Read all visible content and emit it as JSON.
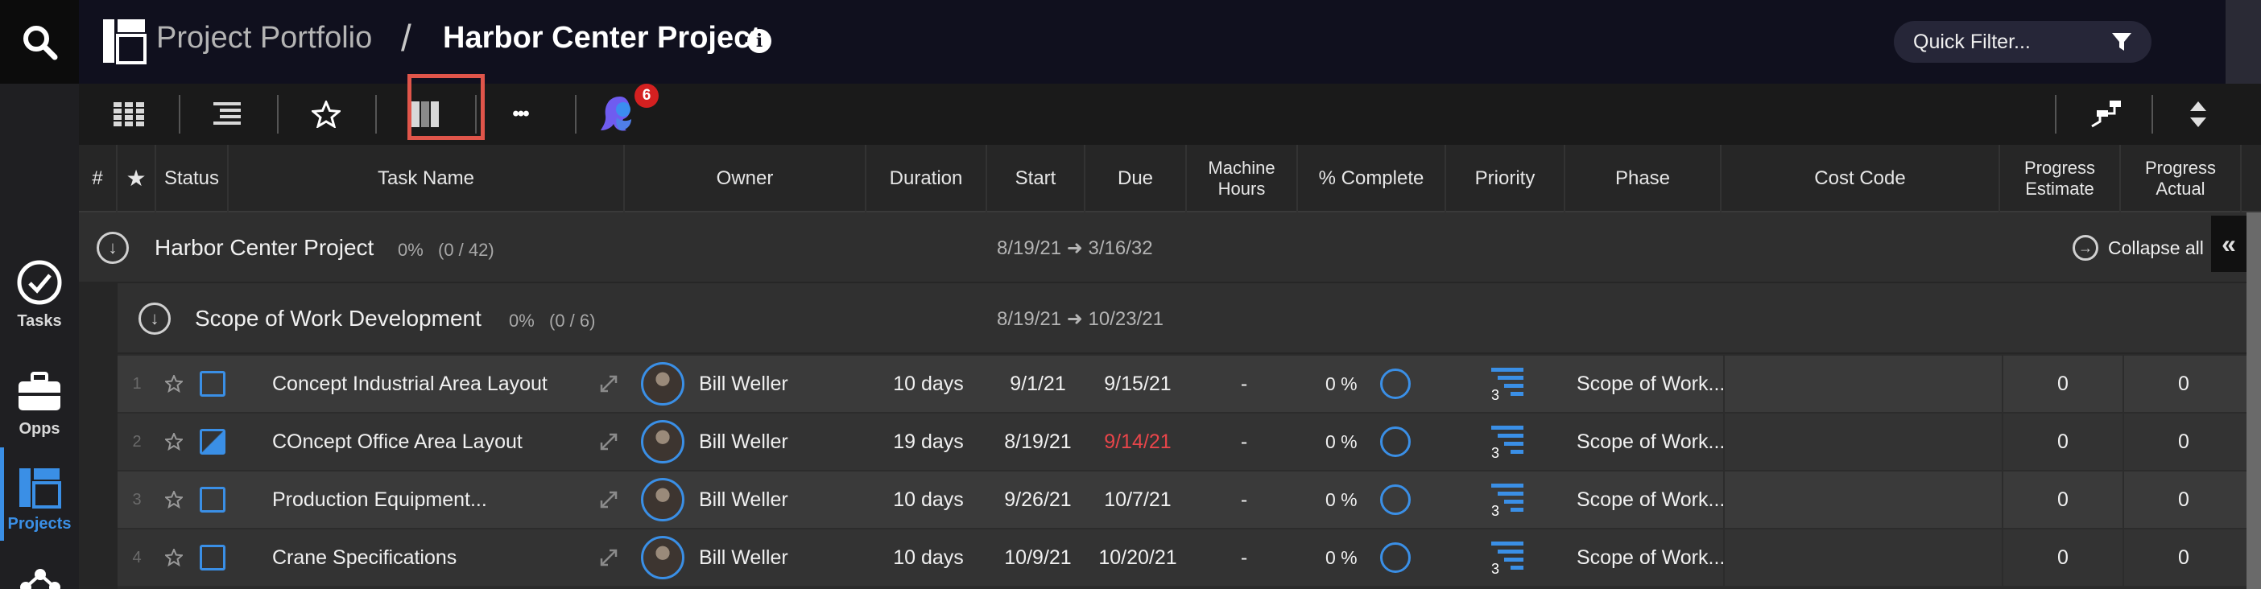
{
  "header": {
    "portfolio": "Project Portfolio",
    "separator": "/",
    "project": "Harbor Center Project",
    "info_glyph": "i",
    "quick_filter_placeholder": "Quick Filter..."
  },
  "sidebar": {
    "items": [
      {
        "label": "Tasks",
        "icon": "check-circle-icon"
      },
      {
        "label": "Opps",
        "icon": "briefcase-icon"
      },
      {
        "label": "Projects",
        "icon": "projects-icon",
        "active": true
      }
    ]
  },
  "toolbar": {
    "more_glyph": "•••",
    "notification_count": "6"
  },
  "columns": {
    "num": "#",
    "star": "★",
    "status": "Status",
    "task_name": "Task Name",
    "owner": "Owner",
    "duration": "Duration",
    "start": "Start",
    "due": "Due",
    "machine_hours_1": "Machine",
    "machine_hours_2": "Hours",
    "complete": "% Complete",
    "priority": "Priority",
    "phase": "Phase",
    "cost_code": "Cost Code",
    "progress_est_1": "Progress",
    "progress_est_2": "Estimate",
    "progress_act_1": "Progress",
    "progress_act_2": "Actual"
  },
  "groups": {
    "project": {
      "name": "Harbor Center Project",
      "percent": "0%",
      "count": "(0 / 42)",
      "dates": "8/19/21 ➜ 3/16/32",
      "collapse_all": "Collapse all"
    },
    "scope": {
      "name": "Scope of Work Development",
      "percent": "0%",
      "count": "(0 / 6)",
      "dates": "8/19/21 ➜ 10/23/21"
    }
  },
  "tasks": [
    {
      "num": "1",
      "name": "Concept Industrial Area Layout",
      "owner": "Bill Weller",
      "duration": "10 days",
      "start": "9/1/21",
      "due": "9/15/21",
      "overdue": false,
      "machine_hours": "-",
      "complete": "0 %",
      "priority": "3",
      "phase": "Scope of Work...",
      "cost_code": "",
      "progress_estimate": "0",
      "progress_actual": "0",
      "checked": false
    },
    {
      "num": "2",
      "name": "COncept Office Area Layout",
      "owner": "Bill Weller",
      "duration": "19 days",
      "start": "8/19/21",
      "due": "9/14/21",
      "overdue": true,
      "machine_hours": "-",
      "complete": "0 %",
      "priority": "3",
      "phase": "Scope of Work...",
      "cost_code": "",
      "progress_estimate": "0",
      "progress_actual": "0",
      "checked": true
    },
    {
      "num": "3",
      "name": "Production Equipment...",
      "owner": "Bill Weller",
      "duration": "10 days",
      "start": "9/26/21",
      "due": "10/7/21",
      "overdue": false,
      "machine_hours": "-",
      "complete": "0 %",
      "priority": "3",
      "phase": "Scope of Work...",
      "cost_code": "",
      "progress_estimate": "0",
      "progress_actual": "0",
      "checked": false
    },
    {
      "num": "4",
      "name": "Crane Specifications",
      "owner": "Bill Weller",
      "duration": "10 days",
      "start": "10/9/21",
      "due": "10/20/21",
      "overdue": false,
      "machine_hours": "-",
      "complete": "0 %",
      "priority": "3",
      "phase": "Scope of Work...",
      "cost_code": "",
      "progress_estimate": "0",
      "progress_actual": "0",
      "checked": false
    }
  ],
  "colors": {
    "accent": "#3a8fe6",
    "overdue": "#e8454a",
    "highlight_box": "#e0554a",
    "badge": "#d42020"
  }
}
